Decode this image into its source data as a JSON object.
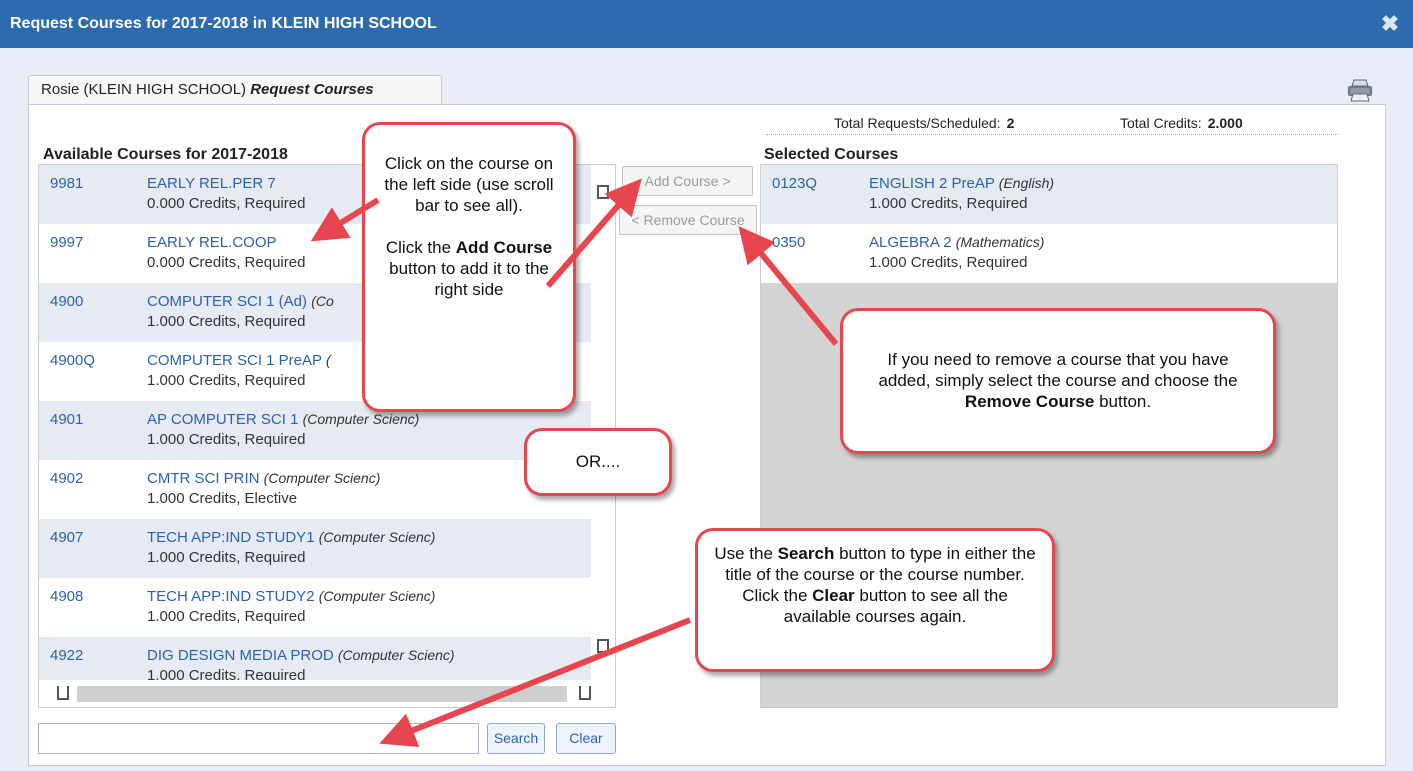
{
  "window": {
    "title": "Request Courses for 2017-2018 in KLEIN HIGH SCHOOL",
    "close_icon": "close-x-icon"
  },
  "tab": {
    "student": "Rosie (KLEIN HIGH SCHOOL)",
    "label": "Request Courses"
  },
  "totals": {
    "requests_label": "Total Requests/Scheduled:",
    "requests_value": "2",
    "credits_label": "Total Credits:",
    "credits_value": "2.000"
  },
  "available": {
    "title": "Available Courses for 2017-2018",
    "courses": [
      {
        "code": "9981",
        "title": "EARLY REL.PER 7",
        "dept": "",
        "credits": "0.000 Credits,  Required"
      },
      {
        "code": "9997",
        "title": "EARLY REL.COOP",
        "dept": "",
        "credits": "0.000 Credits,  Required"
      },
      {
        "code": "4900",
        "title": "COMPUTER SCI 1 (Ad)",
        "dept": "(Co",
        "credits": "1.000 Credits,  Required"
      },
      {
        "code": "4900Q",
        "title": "COMPUTER SCI 1 PreAP",
        "dept": "(",
        "credits": "1.000 Credits,  Required"
      },
      {
        "code": "4901",
        "title": "AP COMPUTER SCI 1",
        "dept": "(Computer Scienc)",
        "credits": "1.000 Credits,  Required"
      },
      {
        "code": "4902",
        "title": "CMTR SCI PRIN",
        "dept": "(Computer Scienc)",
        "credits": "1.000 Credits,  Elective"
      },
      {
        "code": "4907",
        "title": "TECH APP:IND STUDY1",
        "dept": "(Computer Scienc)",
        "credits": "1.000 Credits,  Required"
      },
      {
        "code": "4908",
        "title": "TECH APP:IND STUDY2",
        "dept": "(Computer Scienc)",
        "credits": "1.000 Credits,  Required"
      },
      {
        "code": "4922",
        "title": "DIG DESIGN MEDIA PROD",
        "dept": "(Computer Scienc)",
        "credits": "1.000 Credits,  Required"
      }
    ]
  },
  "buttons": {
    "add": "Add Course >",
    "remove": "< Remove Course",
    "search": "Search",
    "clear": "Clear"
  },
  "selected": {
    "title": "Selected Courses",
    "courses": [
      {
        "code": "0123Q",
        "title": "ENGLISH 2 PreAP",
        "dept": "(English)",
        "credits": "1.000 Credits,  Required"
      },
      {
        "code": "0350",
        "title": "ALGEBRA 2",
        "dept": "(Mathematics)",
        "credits": "1.000 Credits,  Required"
      }
    ]
  },
  "search": {
    "value": "",
    "placeholder": ""
  },
  "callouts": {
    "add_1": "Click on the course on the left side (use scroll bar to see all).",
    "add_2a": "Click the ",
    "add_2b": "Add Course",
    "add_2c": " button to add it to the right side",
    "remove_a": "If you need to remove a course that you have added, simply select the course and choose the ",
    "remove_b": "Remove Course",
    "remove_c": " button.",
    "or": "OR....",
    "search_a": "Use the ",
    "search_b": "Search",
    "search_c": " button to type in either the title of the course or the course number.  Click the ",
    "search_d": "Clear",
    "search_e": " button to see all the available courses again."
  },
  "colors": {
    "titlebar": "#2e6aae",
    "link": "#2a62ad",
    "callout_border": "#e8464e"
  }
}
